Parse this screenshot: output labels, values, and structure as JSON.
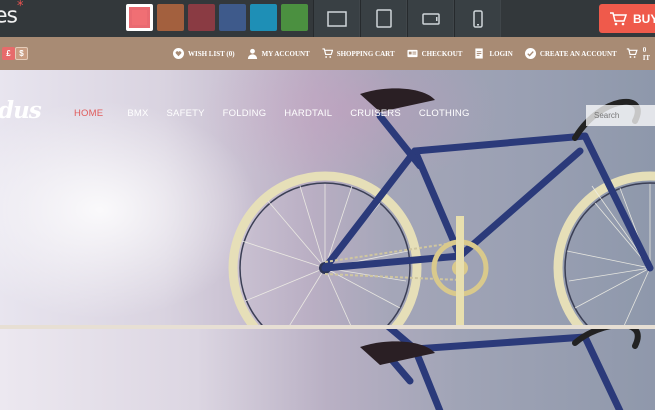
{
  "topbar": {
    "brand": "es",
    "brand_mark": "*",
    "swatches": [
      "#f06f74",
      "#a3603e",
      "#8a3b43",
      "#3e5a8b",
      "#1e8fb6",
      "#4b9040"
    ],
    "devices": [
      "desktop-icon",
      "tablet-landscape-icon",
      "tablet-portrait-icon",
      "phone-icon"
    ],
    "buy_label": "BUY"
  },
  "utilbar": {
    "currencies": [
      "£",
      "$"
    ],
    "links": [
      {
        "icon": "heart-icon",
        "label": "WISH LIST (0)"
      },
      {
        "icon": "user-icon",
        "label": "MY ACCOUNT"
      },
      {
        "icon": "cart-icon",
        "label": "SHOPPING CART"
      },
      {
        "icon": "card-icon",
        "label": "CHECKOUT"
      },
      {
        "icon": "login-icon",
        "label": "LOGIN"
      },
      {
        "icon": "check-circle-icon",
        "label": "CREATE AN ACCOUNT"
      }
    ],
    "cart_count": "0 IT"
  },
  "hero": {
    "logo": "dus",
    "nav": [
      "HOME",
      "BMX",
      "SAFETY",
      "FOLDING",
      "HARDTAIL",
      "CRUISERS",
      "CLOTHING"
    ],
    "search_placeholder": "Search"
  }
}
